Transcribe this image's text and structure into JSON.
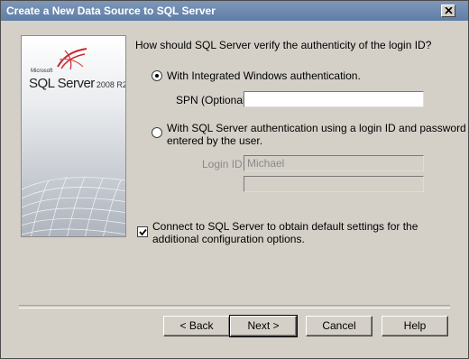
{
  "window": {
    "title": "Create a New Data Source to SQL Server"
  },
  "branding": {
    "microsoft": "Microsoft",
    "product": "SQL Server",
    "version": "2008 R2"
  },
  "auth": {
    "question": "How should SQL Server verify the authenticity of the login ID?",
    "integrated_label": "With Integrated Windows authentication.",
    "integrated_selected": true,
    "spn_label": "SPN (Optional):",
    "spn_value": "",
    "sql_label_line1": "With SQL Server authentication using a login ID and password",
    "sql_label_line2": "entered by the user.",
    "sql_selected": false,
    "login_label": "Login ID:",
    "login_value": "Michael",
    "password_value": ""
  },
  "connect": {
    "label_line1": "Connect to SQL Server to obtain default settings for the",
    "label_line2": "additional configuration options.",
    "checked": true
  },
  "buttons": {
    "back": "< Back",
    "next": "Next >",
    "cancel": "Cancel",
    "help": "Help"
  },
  "icons": {
    "close": "close-icon",
    "logo": "sql-server-logo-icon",
    "checkmark": "checkmark-icon"
  }
}
